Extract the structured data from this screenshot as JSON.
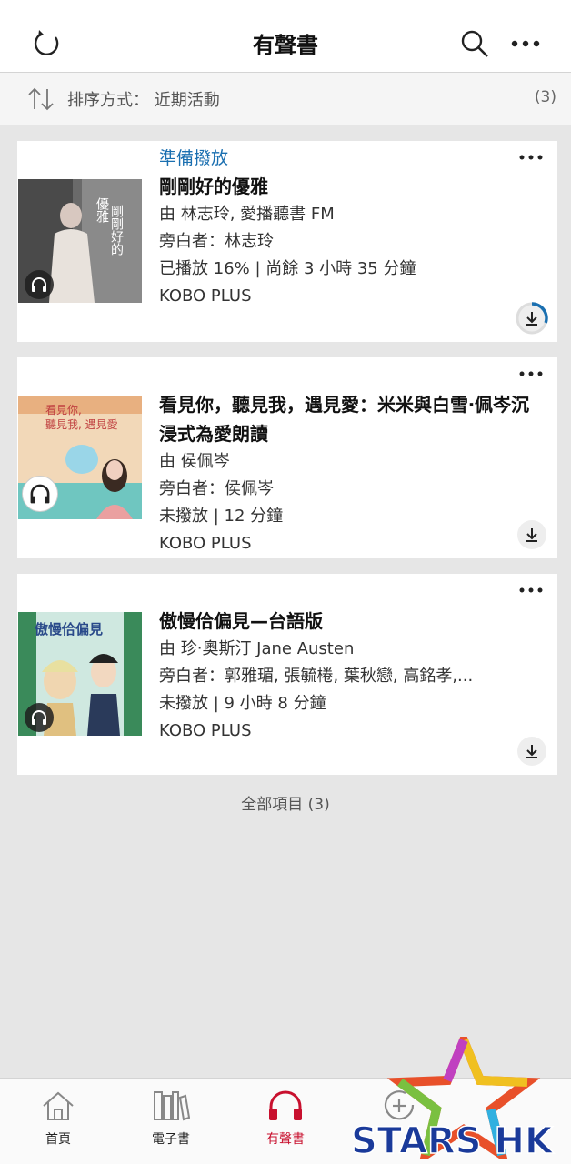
{
  "header": {
    "title": "有聲書"
  },
  "sort": {
    "label": "排序方式： 近期活動",
    "count": "(3)"
  },
  "books": [
    {
      "status": "準備撥放",
      "title": "剛剛好的優雅",
      "author": "由 林志玲, 愛播聽書 FM",
      "narrator": "旁白者：林志玲",
      "progress": "已播放 16% | 尚餘 3 小時 35 分鐘",
      "plan": "KOBO PLUS",
      "download_progress": 0.3,
      "cover_text": "剛剛好的 優雅"
    },
    {
      "status": "",
      "title": "看見你，聽見我，遇見愛：米米與白雪‧佩岑沉浸式為愛朗讀",
      "author": "由 侯佩岑",
      "narrator": "旁白者：侯佩岑",
      "progress": "未撥放 | 12 分鐘",
      "plan": "KOBO PLUS",
      "cover_text": "看見你, 聽見我, 遇見愛"
    },
    {
      "status": "",
      "title": "傲慢佮偏見—台語版",
      "author": "由 珍‧奧斯汀 Jane Austen",
      "narrator": "旁白者：郭雅瑂, 張毓棬, 葉秋戀, 高銘孝,...",
      "progress": "未撥放 | 9 小時 8 分鐘",
      "plan": "KOBO PLUS",
      "cover_text": "傲慢佮偏見"
    }
  ],
  "footer": {
    "all_items": "全部項目 (3)"
  },
  "nav": [
    {
      "label": "首頁",
      "icon": "home-icon"
    },
    {
      "label": "電子書",
      "icon": "books-icon"
    },
    {
      "label": "有聲書",
      "icon": "headphones-icon",
      "active": true
    },
    {
      "label": "",
      "icon": "add-circle-icon"
    }
  ],
  "logo": {
    "text": "STARS HK"
  },
  "colors": {
    "accent": "#1a6fb0",
    "active": "#c8102e"
  }
}
